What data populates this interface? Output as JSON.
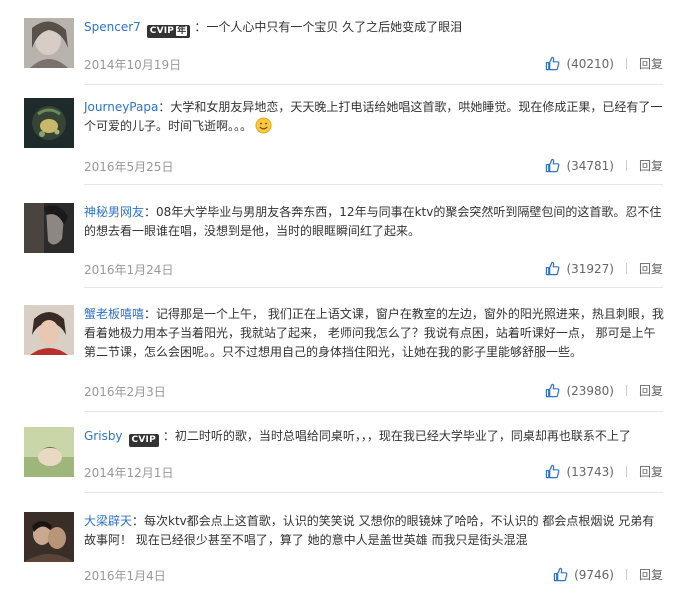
{
  "labels": {
    "reply": "回复",
    "separator": "："
  },
  "comments": [
    {
      "user": "Spencer7",
      "vip_badge": {
        "main": "CVIP",
        "suffix": "年"
      },
      "text": "一个人心中只有一个宝贝 久了之后她变成了眼泪",
      "date": "2014年10月19日",
      "likes": "(40210)"
    },
    {
      "user": "JourneyPapa",
      "text": "大学和女朋友异地恋，天天晚上打电话给她唱这首歌，哄她睡觉。现在修成正果，已经有了一个可爱的儿子。时间飞逝啊。。。",
      "emoji": "smile-emoji",
      "date": "2016年5月25日",
      "likes": "(34781)"
    },
    {
      "user": "神秘男网友",
      "text": "08年大学毕业与男朋友各奔东西，12年与同事在ktv的聚会突然听到隔壁包间的这首歌。忍不住的想去看一眼谁在唱，没想到是他，当时的眼眶瞬间红了起来。",
      "date": "2016年1月24日",
      "likes": "(31927)"
    },
    {
      "user": "蟹老板嘻嘻",
      "text": "记得那是一个上午， 我们正在上语文课，窗户在教室的左边，窗外的阳光照进来，热且刺眼，我看着她极力用本子当着阳光，我就站了起来， 老师问我怎么了？我说有点困，站着听课好一点， 那可是上午第二节课，怎么会困呢。。只不过想用自己的身体挡住阳光，让她在我的影子里能够舒服一些。",
      "date": "2016年2月3日",
      "likes": "(23980)"
    },
    {
      "user": "Grisby",
      "vip_badge": {
        "main": "CVIP"
      },
      "text": "初二时听的歌，当时总唱给同桌听，，，现在我已经大学毕业了，同桌却再也联系不上了",
      "date": "2014年12月1日",
      "likes": "(13743)"
    },
    {
      "user": "大梁辟天",
      "text": "每次ktv都会点上这首歌，认识的笑笑说 又想你的眼镜妹了哈哈，不认识的 都会点根烟说 兄弟有故事阿！ 现在已经很少甚至不唱了，算了 她的意中人是盖世英雄 而我只是街头混混",
      "date": "2016年1月4日",
      "likes": "(9746)"
    }
  ]
}
